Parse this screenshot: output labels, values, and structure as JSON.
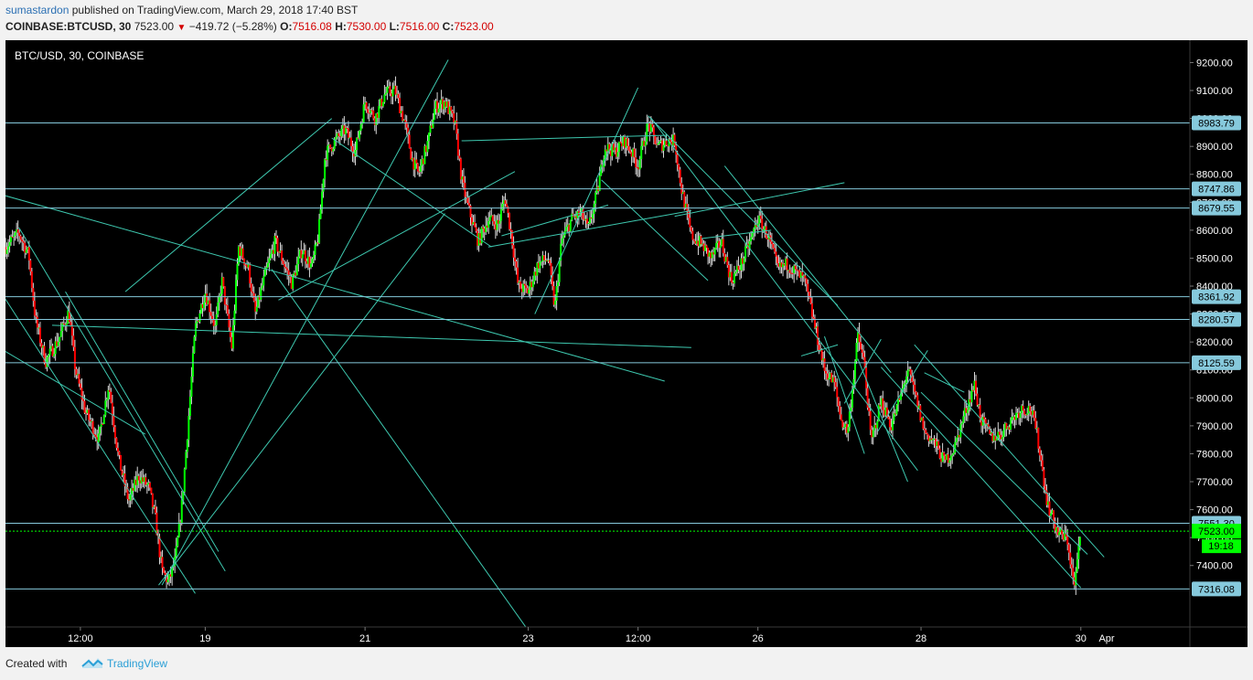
{
  "header": {
    "author": "sumastardon",
    "published_text": "published on TradingView.com, March 29, 2018 17:40 BST",
    "symbol_label": "COINBASE:BTCUSD, 30",
    "last": "7523.00",
    "change": "−419.72 (−5.28%)",
    "o_label": "O:",
    "o_value": "7516.08",
    "h_label": "H:",
    "h_value": "7530.00",
    "l_label": "L:",
    "l_value": "7516.00",
    "c_label": "C:",
    "c_value": "7523.00"
  },
  "footer": {
    "created_with": "Created with",
    "brand": "TradingView"
  },
  "colors": {
    "background": "#000000",
    "up": "#00ff00",
    "down": "#ff0000",
    "wick": "#d8d8d8",
    "trendline": "#3ec9b0",
    "hline": "#86c9dc",
    "price_box": "#86c9dc",
    "last_price": "#00ff00",
    "axis_text": "#ffffff",
    "axis_bg": "#000000"
  },
  "chart_data": {
    "type": "candlestick",
    "title": "BTC/USD, 30, COINBASE",
    "interval": "30",
    "yaxis": {
      "min": 7180,
      "max": 9280,
      "ticks": [
        7400,
        7500,
        7600,
        7700,
        7800,
        7900,
        8000,
        8100,
        8200,
        8300,
        8400,
        8500,
        8600,
        8700,
        8800,
        8900,
        9000,
        9100,
        9200
      ],
      "tick_labels": [
        "7400.00",
        "7500.00",
        "7600.00",
        "7700.00",
        "7800.00",
        "7900.00",
        "8000.00",
        "8100.00",
        "8200.00",
        "8300.00",
        "8400.00",
        "8500.00",
        "8600.00",
        "8700.00",
        "8800.00",
        "8900.00",
        "9000.00",
        "9100.00",
        "9200.00"
      ]
    },
    "xaxis": {
      "start": 0,
      "end": 36.4,
      "ticks": [
        {
          "t": 2.25,
          "label": "12:00"
        },
        {
          "t": 6,
          "label": "19"
        },
        {
          "t": 10.8,
          "label": "21"
        },
        {
          "t": 15.7,
          "label": "23"
        },
        {
          "t": 19,
          "label": "12:00"
        },
        {
          "t": 22.6,
          "label": "26"
        },
        {
          "t": 27.5,
          "label": "28"
        },
        {
          "t": 32.3,
          "label": "30"
        },
        {
          "t": 37.1,
          "label": "Apr"
        }
      ]
    },
    "horizontal_levels": [
      {
        "price": 8983.79,
        "label": "8983.79"
      },
      {
        "price": 8747.86,
        "label": "8747.86"
      },
      {
        "price": 8679.55,
        "label": "8679.55"
      },
      {
        "price": 8361.92,
        "label": "8361.92"
      },
      {
        "price": 8280.57,
        "label": "8280.57"
      },
      {
        "price": 8125.59,
        "label": "8125.59"
      },
      {
        "price": 7551.3,
        "label": "7551.30"
      },
      {
        "price": 7316.08,
        "label": "7316.08"
      }
    ],
    "last_price": {
      "price": 7523.0,
      "label": "7523.00",
      "countdown": "19:18"
    },
    "path": [
      [
        0,
        8540
      ],
      [
        0.4,
        8590
      ],
      [
        0.7,
        8510
      ],
      [
        0.9,
        8280
      ],
      [
        1.2,
        8130
      ],
      [
        1.6,
        8210
      ],
      [
        1.9,
        8310
      ],
      [
        2.1,
        8100
      ],
      [
        2.4,
        7950
      ],
      [
        2.8,
        7850
      ],
      [
        3.1,
        8050
      ],
      [
        3.4,
        7780
      ],
      [
        3.7,
        7630
      ],
      [
        4.0,
        7720
      ],
      [
        4.3,
        7680
      ],
      [
        4.5,
        7570
      ],
      [
        4.7,
        7380
      ],
      [
        4.9,
        7340
      ],
      [
        5.1,
        7420
      ],
      [
        5.3,
        7620
      ],
      [
        5.5,
        7930
      ],
      [
        5.7,
        8250
      ],
      [
        6.0,
        8380
      ],
      [
        6.3,
        8250
      ],
      [
        6.5,
        8420
      ],
      [
        6.8,
        8180
      ],
      [
        7.0,
        8540
      ],
      [
        7.3,
        8460
      ],
      [
        7.5,
        8300
      ],
      [
        7.8,
        8440
      ],
      [
        8.1,
        8560
      ],
      [
        8.4,
        8470
      ],
      [
        8.6,
        8410
      ],
      [
        8.9,
        8530
      ],
      [
        9.2,
        8470
      ],
      [
        9.4,
        8580
      ],
      [
        9.6,
        8870
      ],
      [
        9.9,
        8920
      ],
      [
        10.2,
        8960
      ],
      [
        10.5,
        8880
      ],
      [
        10.8,
        9060
      ],
      [
        11.1,
        9000
      ],
      [
        11.4,
        9090
      ],
      [
        11.7,
        9100
      ],
      [
        12.0,
        8980
      ],
      [
        12.2,
        8860
      ],
      [
        12.4,
        8800
      ],
      [
        12.7,
        8920
      ],
      [
        12.9,
        9040
      ],
      [
        13.2,
        9060
      ],
      [
        13.5,
        8980
      ],
      [
        13.7,
        8780
      ],
      [
        13.9,
        8680
      ],
      [
        14.2,
        8560
      ],
      [
        14.5,
        8640
      ],
      [
        14.8,
        8620
      ],
      [
        15.0,
        8720
      ],
      [
        15.2,
        8580
      ],
      [
        15.4,
        8400
      ],
      [
        15.7,
        8380
      ],
      [
        16.0,
        8480
      ],
      [
        16.3,
        8500
      ],
      [
        16.5,
        8320
      ],
      [
        16.7,
        8560
      ],
      [
        17.0,
        8640
      ],
      [
        17.3,
        8660
      ],
      [
        17.5,
        8600
      ],
      [
        17.8,
        8750
      ],
      [
        18.0,
        8900
      ],
      [
        18.3,
        8880
      ],
      [
        18.6,
        8920
      ],
      [
        18.8,
        8880
      ],
      [
        19.0,
        8830
      ],
      [
        19.3,
        8980
      ],
      [
        19.6,
        8900
      ],
      [
        19.9,
        8920
      ],
      [
        20.1,
        8920
      ],
      [
        20.3,
        8750
      ],
      [
        20.6,
        8580
      ],
      [
        20.9,
        8550
      ],
      [
        21.2,
        8500
      ],
      [
        21.5,
        8560
      ],
      [
        21.8,
        8420
      ],
      [
        22.1,
        8480
      ],
      [
        22.4,
        8570
      ],
      [
        22.6,
        8640
      ],
      [
        22.9,
        8580
      ],
      [
        23.2,
        8460
      ],
      [
        23.5,
        8480
      ],
      [
        23.8,
        8440
      ],
      [
        24.0,
        8420
      ],
      [
        24.3,
        8260
      ],
      [
        24.6,
        8100
      ],
      [
        24.9,
        8050
      ],
      [
        25.1,
        7920
      ],
      [
        25.3,
        7880
      ],
      [
        25.6,
        8220
      ],
      [
        25.8,
        8120
      ],
      [
        26.0,
        7840
      ],
      [
        26.3,
        7990
      ],
      [
        26.6,
        7900
      ],
      [
        26.9,
        8010
      ],
      [
        27.1,
        8100
      ],
      [
        27.3,
        8020
      ],
      [
        27.6,
        7880
      ],
      [
        27.9,
        7840
      ],
      [
        28.2,
        7770
      ],
      [
        28.5,
        7820
      ],
      [
        28.8,
        7940
      ],
      [
        29.1,
        8050
      ],
      [
        29.3,
        7920
      ],
      [
        29.6,
        7860
      ],
      [
        29.9,
        7870
      ],
      [
        30.2,
        7920
      ],
      [
        30.5,
        7960
      ],
      [
        30.8,
        7960
      ],
      [
        31.0,
        7860
      ],
      [
        31.3,
        7620
      ],
      [
        31.6,
        7520
      ],
      [
        31.9,
        7490
      ],
      [
        32.1,
        7320
      ],
      [
        32.3,
        7520
      ]
    ],
    "trendlines": [
      [
        [
          -0.2,
          8390
        ],
        [
          5.7,
          7300
        ]
      ],
      [
        [
          0.4,
          8610
        ],
        [
          6.6,
          7380
        ]
      ],
      [
        [
          -0.2,
          8180
        ],
        [
          4.2,
          7870
        ]
      ],
      [
        [
          1.8,
          8380
        ],
        [
          6.4,
          7450
        ]
      ],
      [
        [
          -0.2,
          8730
        ],
        [
          19.8,
          8060
        ]
      ],
      [
        [
          1.4,
          8260
        ],
        [
          20.6,
          8180
        ]
      ],
      [
        [
          3.6,
          8380
        ],
        [
          9.8,
          9000
        ]
      ],
      [
        [
          4.7,
          7330
        ],
        [
          13.3,
          9210
        ]
      ],
      [
        [
          4.6,
          7330
        ],
        [
          13.2,
          8660
        ]
      ],
      [
        [
          8.0,
          8460
        ],
        [
          16.7,
          7000
        ]
      ],
      [
        [
          9.8,
          8930
        ],
        [
          14.6,
          8540
        ]
      ],
      [
        [
          8.2,
          8350
        ],
        [
          15.3,
          8810
        ]
      ],
      [
        [
          14.5,
          8540
        ],
        [
          20.6,
          8670
        ]
      ],
      [
        [
          15.9,
          8300
        ],
        [
          19.0,
          9110
        ]
      ],
      [
        [
          14.9,
          8580
        ],
        [
          18.1,
          8690
        ]
      ],
      [
        [
          17.9,
          8780
        ],
        [
          21.1,
          8420
        ]
      ],
      [
        [
          13.7,
          8920
        ],
        [
          19.9,
          8940
        ]
      ],
      [
        [
          19.3,
          9010
        ],
        [
          25.0,
          8330
        ]
      ],
      [
        [
          19.4,
          9000
        ],
        [
          27.4,
          7740
        ]
      ],
      [
        [
          20.1,
          8650
        ],
        [
          25.2,
          8770
        ]
      ],
      [
        [
          20.9,
          8570
        ],
        [
          23.0,
          8600
        ]
      ],
      [
        [
          21.6,
          8830
        ],
        [
          26.6,
          8090
        ]
      ],
      [
        [
          23.9,
          8150
        ],
        [
          25.0,
          8190
        ]
      ],
      [
        [
          24.6,
          8220
        ],
        [
          25.8,
          7800
        ]
      ],
      [
        [
          25.2,
          7980
        ],
        [
          26.3,
          8210
        ]
      ],
      [
        [
          25.6,
          8140
        ],
        [
          27.1,
          7700
        ]
      ],
      [
        [
          26.2,
          7880
        ],
        [
          27.7,
          8170
        ]
      ],
      [
        [
          27.5,
          8020
        ],
        [
          32.5,
          7440
        ]
      ],
      [
        [
          26.3,
          8110
        ],
        [
          32.3,
          7320
        ]
      ],
      [
        [
          27.3,
          8190
        ],
        [
          33.0,
          7430
        ]
      ],
      [
        [
          27.6,
          8090
        ],
        [
          28.8,
          8020
        ]
      ]
    ]
  }
}
